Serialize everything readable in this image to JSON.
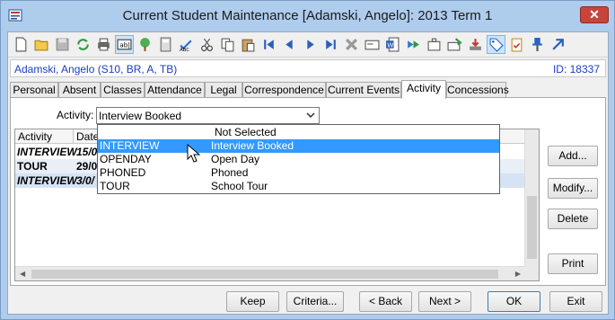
{
  "window": {
    "title": "Current Student Maintenance  [Adamski, Angelo]:  2013 Term 1",
    "close_label": "✕"
  },
  "toolbar": {
    "icons": [
      "new-document",
      "open-folder",
      "save",
      "refresh",
      "print",
      "text-field",
      "tree",
      "calculator",
      "spell-check",
      "cut",
      "copy",
      "paste",
      "first-record",
      "previous-record",
      "next-record",
      "last-record",
      "delete",
      "card",
      "word-document",
      "forward",
      "briefcase",
      "mail-stamp",
      "download-tray",
      "tag",
      "clipboard-check",
      "pin",
      "arrow-up-right"
    ],
    "active_icon": "tag"
  },
  "student": {
    "name": "Adamski, Angelo (S10, BR, A, TB)",
    "id": "ID: 18337"
  },
  "tabs": [
    {
      "label": "Personal"
    },
    {
      "label": "Absent"
    },
    {
      "label": "Classes"
    },
    {
      "label": "Attendance"
    },
    {
      "label": "Legal"
    },
    {
      "label": "Correspondence"
    },
    {
      "label": "Current Events"
    },
    {
      "label": "Activity",
      "active": true
    },
    {
      "label": "Concessions"
    }
  ],
  "activity": {
    "label": "Activity:",
    "selected": "Interview Booked"
  },
  "grid": {
    "headers": [
      "Activity",
      "Date"
    ],
    "rows": [
      {
        "activity": "INTERVIEW",
        "date": "15/0"
      },
      {
        "activity": "TOUR",
        "date": "29/0"
      },
      {
        "activity": "INTERVIEW",
        "date": "3/0/"
      }
    ]
  },
  "dropdown": {
    "options": [
      {
        "code": "",
        "desc": "Not Selected"
      },
      {
        "code": "INTERVIEW",
        "desc": "Interview Booked",
        "selected": true
      },
      {
        "code": "OPENDAY",
        "desc": "Open Day"
      },
      {
        "code": "PHONED",
        "desc": "Phoned"
      },
      {
        "code": "TOUR",
        "desc": "School Tour"
      }
    ]
  },
  "side_buttons": {
    "add": "Add...",
    "modify": "Modify...",
    "delete": "Delete",
    "print": "Print"
  },
  "bottom_buttons": {
    "keep": "Keep",
    "criteria": "Criteria...",
    "back": "< Back",
    "next": "Next >",
    "ok": "OK",
    "exit": "Exit"
  },
  "colors": {
    "frame": "#aeccec",
    "accent_text": "#1a3dc8",
    "selection": "#3399ff",
    "close_button": "#c7443a"
  }
}
